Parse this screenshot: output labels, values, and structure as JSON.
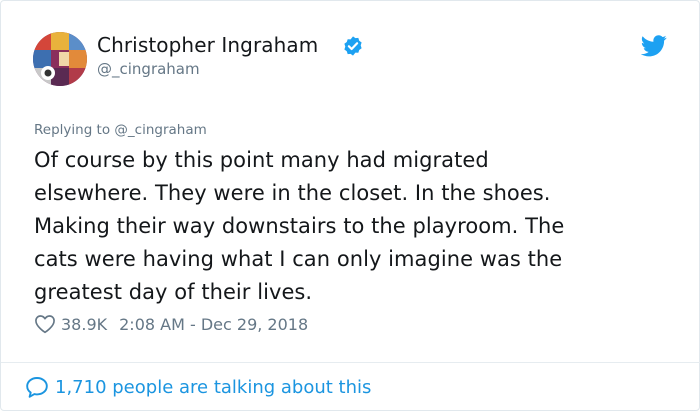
{
  "author": {
    "name": "Christopher Ingraham",
    "handle": "@_cingraham",
    "verified": true
  },
  "reply_context": {
    "prefix": "Replying to",
    "mention": "@_cingraham"
  },
  "tweet": {
    "lines": [
      "Of course by this point many had migrated",
      "elsewhere. They were in the closet. In the shoes.",
      "Making their way downstairs to the playroom. The",
      "cats were having what I can only imagine was the",
      "greatest day of their lives."
    ]
  },
  "meta": {
    "likes": "38.9K",
    "timestamp": "2:08 AM - Dec 29, 2018"
  },
  "footer": {
    "talking": "1,710 people are talking about this"
  },
  "icons": {
    "verified": "verified-badge-icon",
    "brand": "twitter-bird-icon",
    "like": "heart-outline-icon",
    "conversation": "speech-bubble-icon"
  },
  "colors": {
    "brand_blue": "#1da1f2",
    "link_blue": "#1b95e0",
    "secondary_text": "#657786",
    "primary_text": "#14171a"
  }
}
